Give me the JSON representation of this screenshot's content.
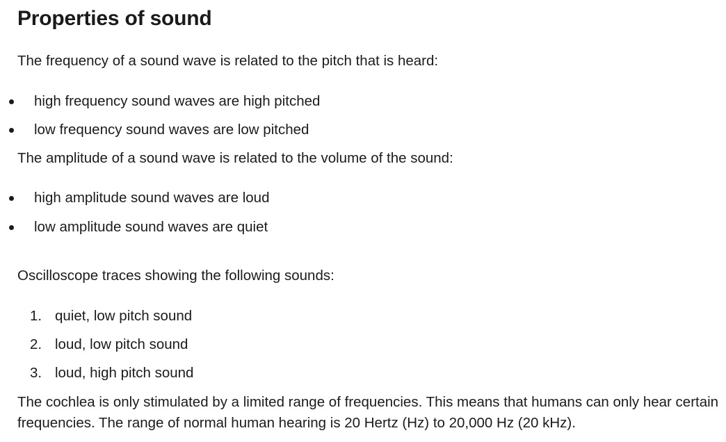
{
  "title": "Properties of sound",
  "frequency_intro": "The frequency of a sound wave is related to the pitch that is heard:",
  "frequency_points": [
    "high frequency sound waves are high pitched",
    "low frequency sound waves are low pitched"
  ],
  "amplitude_intro": "The amplitude of a sound wave is related to the volume of the sound:",
  "amplitude_points": [
    "high amplitude sound waves are loud",
    "low amplitude sound waves are quiet"
  ],
  "oscilloscope_intro": "Oscilloscope traces showing the following sounds:",
  "oscilloscope_list": [
    {
      "marker": "1.",
      "text": "quiet, low pitch sound"
    },
    {
      "marker": "2.",
      "text": "loud, low pitch sound"
    },
    {
      "marker": "3.",
      "text": "loud, high pitch sound"
    }
  ],
  "closing_paragraph": "The cochlea is only stimulated by a limited range of frequencies. This means that humans can only hear certain frequencies. The range of normal human hearing is 20 Hertz (Hz) to 20,000 Hz (20 kHz)."
}
